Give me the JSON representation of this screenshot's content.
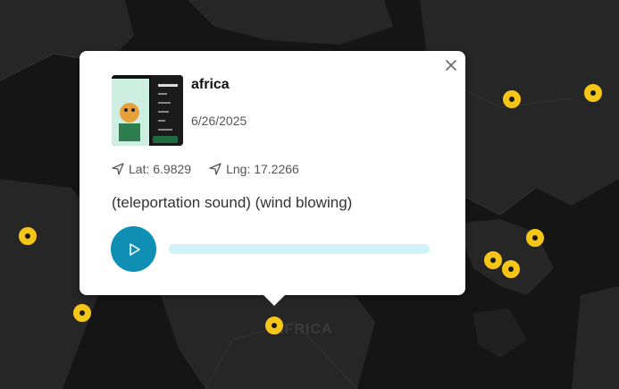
{
  "map": {
    "region_label": "AFRICA",
    "marker_color": "#f5c518",
    "background_color": "#1a1a1a"
  },
  "popup": {
    "title": "africa",
    "date": "6/26/2025",
    "lat_label": "Lat: 6.9829",
    "lng_label": "Lng: 17.2266",
    "description": "(teleportation sound) (wind blowing)",
    "play_icon": "play-icon",
    "close_icon": "close-icon",
    "accent_color": "#0e8fb3",
    "progress": 0.0
  }
}
